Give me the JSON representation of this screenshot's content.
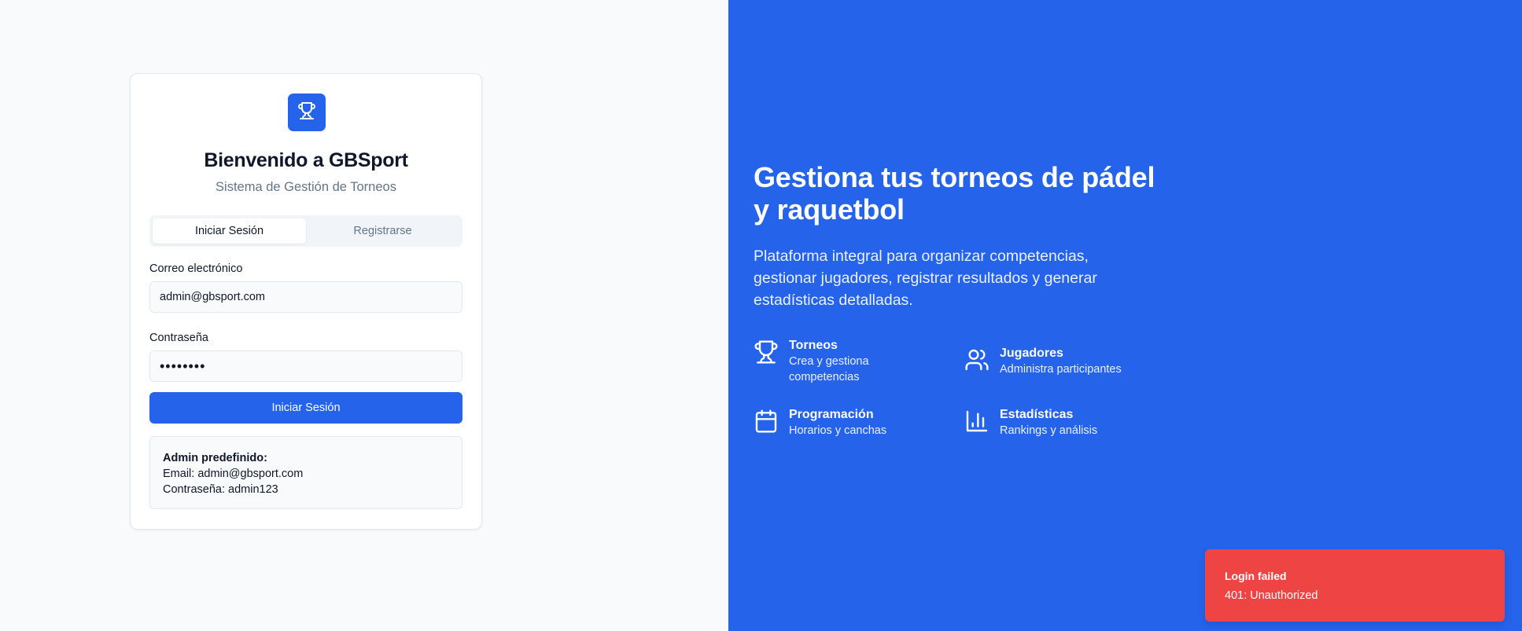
{
  "brand": {
    "accent": "#2563eb",
    "error": "#ef4444"
  },
  "login": {
    "logo_icon": "trophy-icon",
    "title": "Bienvenido a GBSport",
    "subtitle": "Sistema de Gestión de Torneos",
    "tabs": [
      {
        "label": "Iniciar Sesión",
        "active": true
      },
      {
        "label": "Registrarse",
        "active": false
      }
    ],
    "email": {
      "label": "Correo electrónico",
      "value": "admin@gbsport.com"
    },
    "password": {
      "label": "Contraseña",
      "value": "••••••••"
    },
    "submit_label": "Iniciar Sesión",
    "hint": {
      "heading": "Admin predefinido:",
      "email_line": "Email: admin@gbsport.com",
      "password_line": "Contraseña: admin123"
    }
  },
  "hero": {
    "title": "Gestiona tus torneos de pádel y raquetbol",
    "description": "Plataforma integral para organizar competencias, gestionar jugadores, registrar resultados y generar estadísticas detalladas.",
    "features": [
      {
        "icon": "trophy-icon",
        "title": "Torneos",
        "desc": "Crea y gestiona competencias"
      },
      {
        "icon": "users-icon",
        "title": "Jugadores",
        "desc": "Administra participantes"
      },
      {
        "icon": "calendar-icon",
        "title": "Programación",
        "desc": "Horarios y canchas"
      },
      {
        "icon": "bar-chart-icon",
        "title": "Estadísticas",
        "desc": "Rankings y análisis"
      }
    ]
  },
  "toast": {
    "title": "Login failed",
    "message": "401: Unauthorized"
  }
}
